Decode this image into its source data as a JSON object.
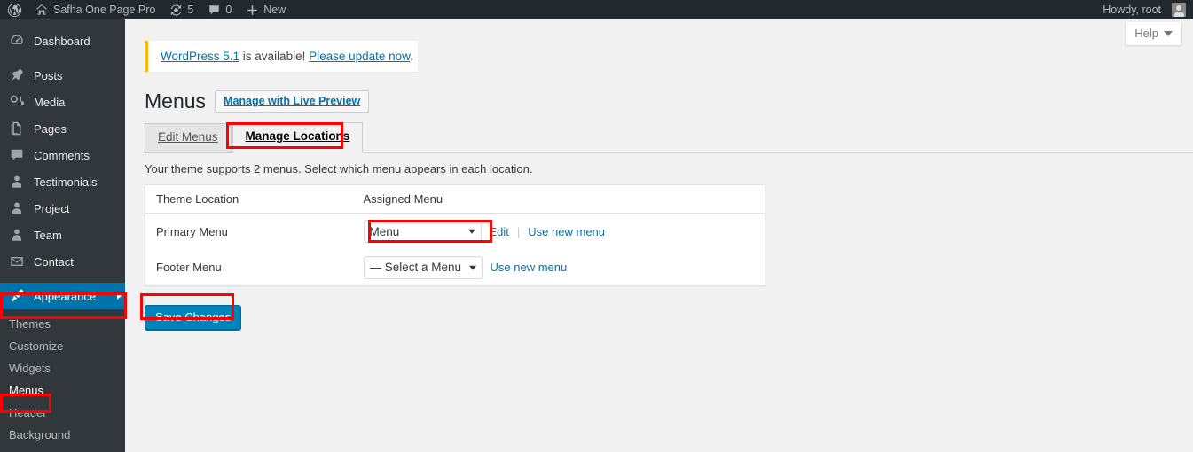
{
  "adminbar": {
    "site_title": "Safha One Page Pro",
    "updates_count": "5",
    "comments_count": "0",
    "new_label": "New",
    "howdy": "Howdy, root"
  },
  "sidebar": {
    "items": [
      {
        "label": "Dashboard",
        "icon": "dashboard-icon"
      },
      {
        "label": "Posts",
        "icon": "pin-icon"
      },
      {
        "label": "Media",
        "icon": "media-icon"
      },
      {
        "label": "Pages",
        "icon": "pages-icon"
      },
      {
        "label": "Comments",
        "icon": "comments-icon"
      },
      {
        "label": "Testimonials",
        "icon": "user-icon"
      },
      {
        "label": "Project",
        "icon": "user-icon"
      },
      {
        "label": "Team",
        "icon": "user-icon"
      },
      {
        "label": "Contact",
        "icon": "mail-icon"
      },
      {
        "label": "Appearance",
        "icon": "brush-icon"
      }
    ],
    "appearance_submenu": [
      {
        "label": "Themes"
      },
      {
        "label": "Customize"
      },
      {
        "label": "Widgets"
      },
      {
        "label": "Menus"
      },
      {
        "label": "Header"
      },
      {
        "label": "Background"
      }
    ]
  },
  "help": {
    "label": "Help"
  },
  "notice": {
    "link_version": "WordPress 5.1",
    "middle_text": " is available! ",
    "link_update": "Please update now",
    "period": "."
  },
  "page": {
    "title": "Menus",
    "live_preview_button": "Manage with Live Preview",
    "tabs": [
      {
        "label": "Edit Menus",
        "active": false
      },
      {
        "label": "Manage Locations",
        "active": true
      }
    ],
    "description": "Your theme supports 2 menus. Select which menu appears in each location.",
    "table": {
      "headers": [
        "Theme Location",
        "Assigned Menu"
      ],
      "rows": [
        {
          "location": "Primary Menu",
          "selected_menu": "Menu",
          "links": [
            "Edit",
            "Use new menu"
          ]
        },
        {
          "location": "Footer Menu",
          "selected_menu": "— Select a Menu —",
          "links": [
            "Use new menu"
          ]
        }
      ]
    },
    "save_button": "Save Changes"
  },
  "colors": {
    "admin_bar": "#23282d",
    "sidebar": "#32373c",
    "accent": "#0073aa",
    "button": "#0085ba",
    "highlight_box": "#ff0000",
    "notice_border": "#ffb900"
  }
}
